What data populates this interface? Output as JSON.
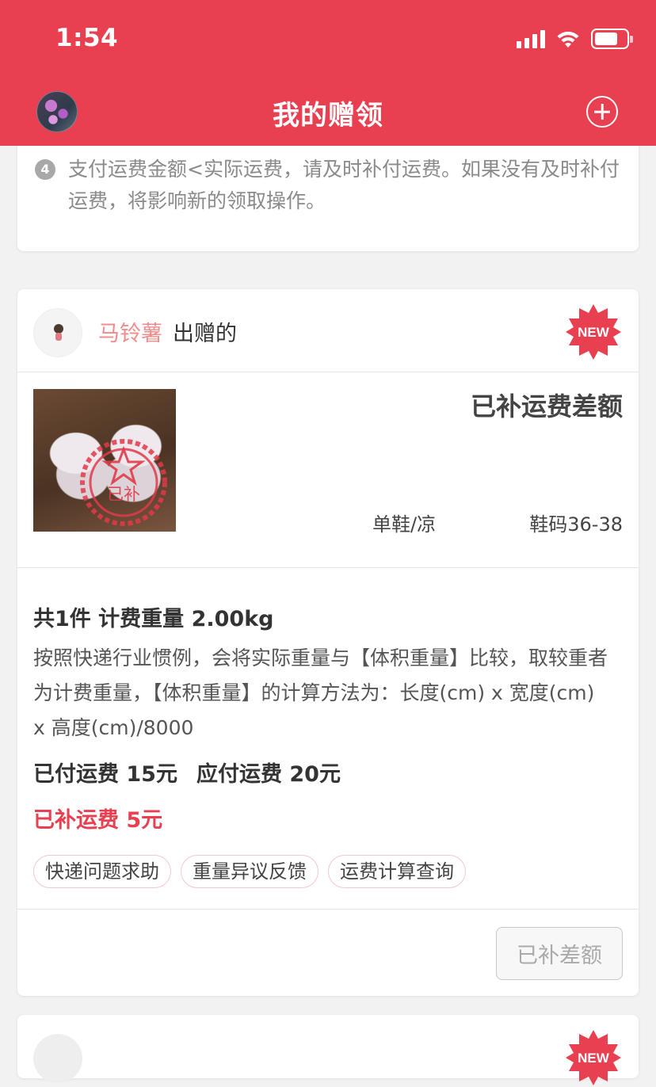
{
  "status_bar": {
    "time": "1:54"
  },
  "header": {
    "title": "我的赠领"
  },
  "notice": {
    "number": "4",
    "text": "支付运费金额<实际运费，请及时补付运费。如果没有及时补付运费，将影响新的领取操作。"
  },
  "order": {
    "giver_name": "马铃薯",
    "giver_suffix": "出赠的",
    "badge": "NEW",
    "status": "已补运费差额",
    "stamp_text": "已补",
    "item_type": "单鞋/凉",
    "item_size": "鞋码36-38",
    "summary": "共1件 计费重量 2.00kg",
    "explain": "按照快递行业惯例，会将实际重量与【体积重量】比较，取较重者为计费重量，【体积重量】的计算方法为：长度(cm) x 宽度(cm) x 高度(cm)/8000",
    "paid_fee": "已付运费 15元",
    "due_fee": "应付运费 20元",
    "extra_fee": "已补运费 5元",
    "tags": [
      "快递问题求助",
      "重量异议反馈",
      "运费计算查询"
    ],
    "action_button": "已补差额"
  },
  "next_order": {
    "giver_name": "",
    "giver_suffix": "",
    "badge": "NEW"
  },
  "colors": {
    "brand": "#e84050",
    "accent_text": "#ef8c8c",
    "muted": "#8a8a8a"
  }
}
